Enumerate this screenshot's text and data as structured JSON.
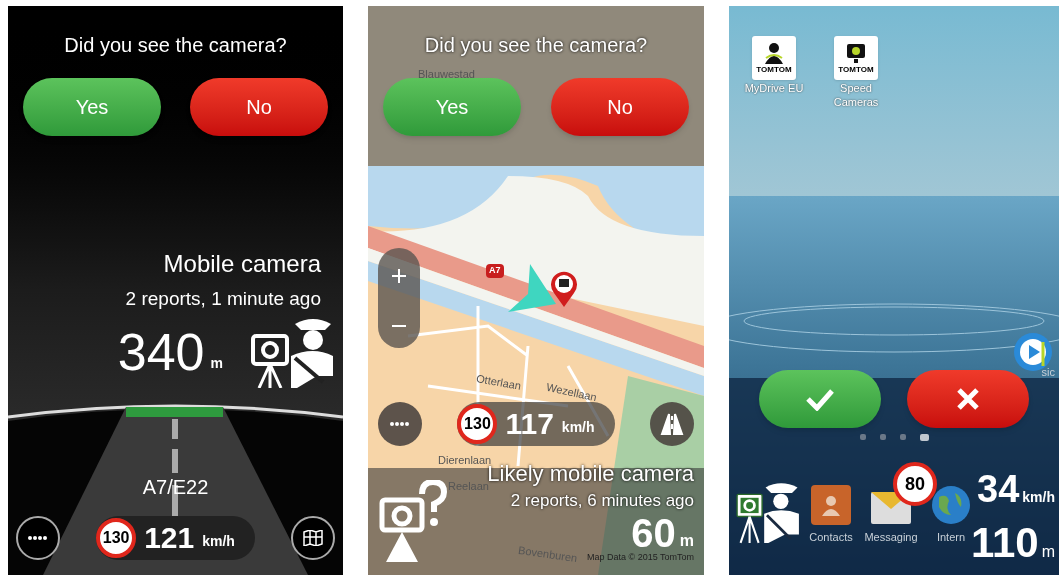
{
  "panels": [
    {
      "kind": "drive",
      "question": "Did you see the camera?",
      "buttons": [
        {
          "kind": "yes",
          "label": "Yes"
        },
        {
          "kind": "no",
          "label": "No"
        }
      ],
      "alert": {
        "title": "Mobile camera",
        "subtitle": "2 reports, 1 minute ago",
        "distance": "340",
        "distance_unit": "m"
      },
      "road_name": "A7/E22",
      "speed_limit": "130",
      "speed": "121",
      "speed_unit": "km/h"
    },
    {
      "kind": "map",
      "question": "Did you see the camera?",
      "buttons": [
        {
          "kind": "yes",
          "label": "Yes"
        },
        {
          "kind": "no",
          "label": "No"
        }
      ],
      "map_labels": [
        {
          "text": "Blauwestad"
        },
        {
          "text": "A7",
          "kind": "shield"
        },
        {
          "text": "Otterlaan"
        },
        {
          "text": "Wezellaan"
        },
        {
          "text": "Dierenlaan"
        },
        {
          "text": "Reelaan"
        },
        {
          "text": "Bovenburen"
        }
      ],
      "speed_limit": "130",
      "speed": "117",
      "speed_unit": "km/h",
      "alert": {
        "title": "Likely mobile camera",
        "subtitle": "2 reports, 6 minutes ago",
        "distance": "60",
        "distance_unit": "m"
      },
      "attribution": "Map Data © 2015 TomTom"
    },
    {
      "kind": "home",
      "apps": [
        {
          "kind": "driver",
          "label": "MyDrive EU",
          "brand": "TOMTOM"
        },
        {
          "kind": "camera",
          "label": "Speed Cameras",
          "brand": "TOMTOM"
        }
      ],
      "music_label": "sic",
      "buttons": [
        {
          "kind": "confirm"
        },
        {
          "kind": "reject"
        }
      ],
      "page_dots": [
        {
          "selected": false
        },
        {
          "selected": false
        },
        {
          "selected": false
        },
        {
          "selected": true
        }
      ],
      "dock": [
        {
          "kind": "contacts",
          "label": "Contacts"
        },
        {
          "kind": "messaging",
          "label": "Messaging"
        },
        {
          "kind": "globe",
          "label": "Intern"
        }
      ],
      "speed_limit": "80",
      "speed": "34",
      "speed_unit": "km/h",
      "distance": "110",
      "distance_unit": "m"
    }
  ]
}
